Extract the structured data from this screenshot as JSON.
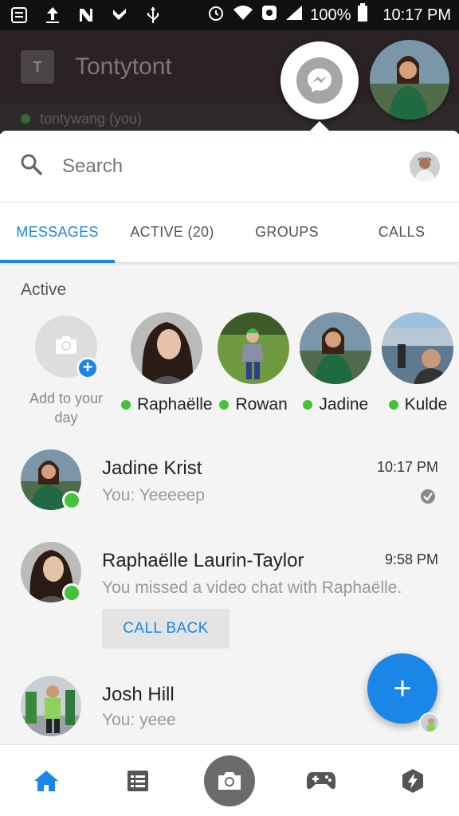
{
  "status_bar": {
    "battery": "100%",
    "time": "10:17 PM"
  },
  "background_app": {
    "logo_letter": "T",
    "title": "Tontytont",
    "user_line": "tontywang (you)"
  },
  "search": {
    "placeholder": "Search"
  },
  "tabs": [
    {
      "label": "MESSAGES",
      "active": true
    },
    {
      "label": "ACTIVE (20)",
      "active": false
    },
    {
      "label": "GROUPS",
      "active": false
    },
    {
      "label": "CALLS",
      "active": false
    }
  ],
  "active_section": {
    "title": "Active",
    "add_story_label": "Add to your day",
    "people": [
      {
        "name": "Raphaëlle"
      },
      {
        "name": "Rowan"
      },
      {
        "name": "Jadine"
      },
      {
        "name": "Kulde"
      }
    ]
  },
  "conversations": [
    {
      "name": "Jadine Krist",
      "time": "10:17 PM",
      "snippet": "You: Yeeeeep",
      "online": true,
      "seen": true
    },
    {
      "name": "Raphaëlle Laurin-Taylor",
      "time": "9:58 PM",
      "snippet": "You missed a video chat with Raphaëlle.",
      "online": true,
      "action_label": "CALL BACK"
    },
    {
      "name": "Josh Hill",
      "time": "",
      "snippet": "You: yeee",
      "online": false
    }
  ],
  "fab": {
    "icon": "plus-icon",
    "label": "+"
  },
  "bottom_nav": [
    "home-icon",
    "list-icon",
    "camera-icon",
    "games-icon",
    "discover-icon"
  ],
  "colors": {
    "accent": "#1a86e8",
    "online": "#44c23a"
  }
}
